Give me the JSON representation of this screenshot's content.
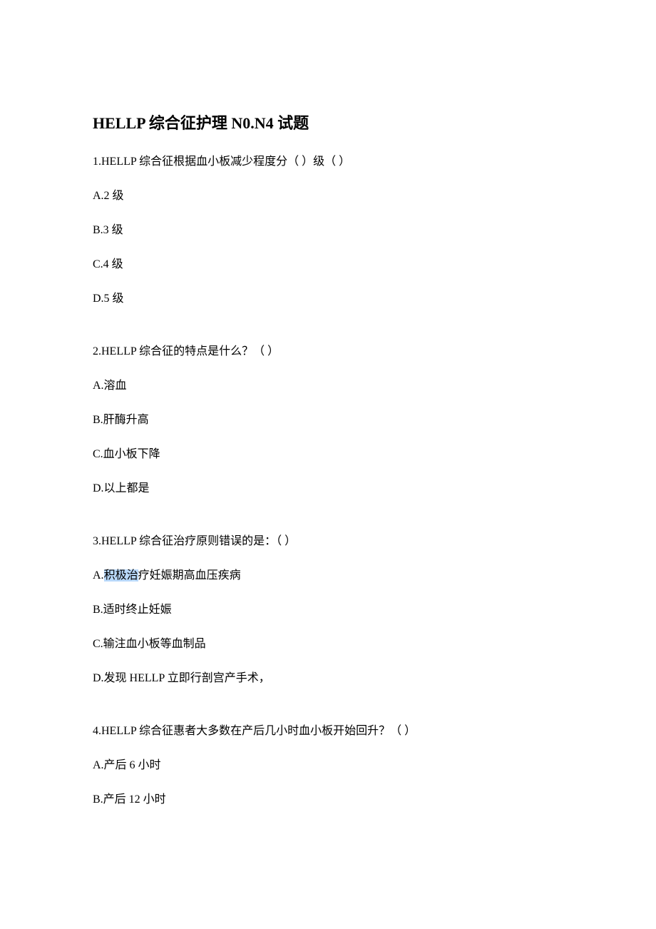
{
  "title": "HELLP 综合征护理 N0.N4 试题",
  "questions": [
    {
      "stem": "1.HELLP 综合征根据血小板减少程度分（ ）级（ ）",
      "options": [
        "A.2 级",
        "B.3 级",
        "C.4 级",
        "D.5 级"
      ]
    },
    {
      "stem": "2.HELLP 综合征的特点是什么？（ ）",
      "options": [
        "A.溶血",
        "B.肝酶升高",
        "C.血小板下降",
        "D.以上都是"
      ]
    },
    {
      "stem": "3.HELLP 综合征治疗原则错误的是：（ ）",
      "options": [
        "A.积极治疗妊娠期高血压疾病",
        "B.适时终止妊娠",
        "C.输注血小板等血制品",
        "D.发现 HELLP 立即行剖宫产手术，"
      ],
      "highlightOptionIndex": 0,
      "highlightText": "积极治"
    },
    {
      "stem": "4.HELLP 综合征惠者大多数在产后几小时血小板开始回升？（ ）",
      "options": [
        "A.产后 6 小时",
        "B.产后 12 小时"
      ]
    }
  ]
}
